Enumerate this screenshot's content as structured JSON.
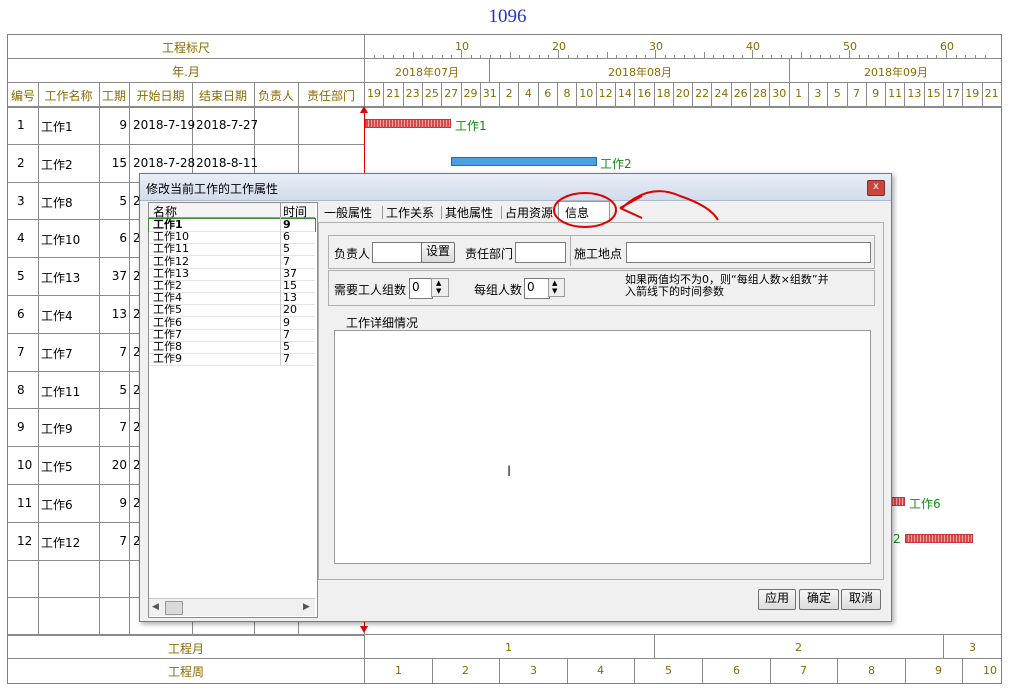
{
  "page_number": "1096",
  "header": {
    "ruler_label": "工程标尺",
    "month_label": "年.月",
    "ruler_ticks": [
      "10",
      "20",
      "30",
      "40",
      "50",
      "60"
    ],
    "months": [
      "2018年07月",
      "2018年08月",
      "2018年09月"
    ],
    "days": [
      "19",
      "21",
      "23",
      "25",
      "27",
      "29",
      "31",
      "2",
      "4",
      "6",
      "8",
      "10",
      "12",
      "14",
      "16",
      "18",
      "20",
      "22",
      "24",
      "26",
      "28",
      "30",
      "1",
      "3",
      "5",
      "7",
      "9",
      "11",
      "13",
      "15",
      "17",
      "19",
      "21"
    ]
  },
  "columns": {
    "id": "编号",
    "name": "工作名称",
    "duration": "工期",
    "start": "开始日期",
    "end": "结束日期",
    "owner": "负责人",
    "dept": "责任部门"
  },
  "rows": [
    {
      "id": "1",
      "name": "工作1",
      "dur": "9",
      "start": "2018-7-19",
      "end": "2018-7-27"
    },
    {
      "id": "2",
      "name": "工作2",
      "dur": "15",
      "start": "2018-7-28",
      "end": "2018-8-11"
    },
    {
      "id": "3",
      "name": "工作8",
      "dur": "5",
      "start": "2",
      "end": ""
    },
    {
      "id": "4",
      "name": "工作10",
      "dur": "6",
      "start": "2",
      "end": ""
    },
    {
      "id": "5",
      "name": "工作13",
      "dur": "37",
      "start": "2",
      "end": ""
    },
    {
      "id": "6",
      "name": "工作4",
      "dur": "13",
      "start": "2",
      "end": ""
    },
    {
      "id": "7",
      "name": "工作7",
      "dur": "7",
      "start": "2",
      "end": ""
    },
    {
      "id": "8",
      "name": "工作11",
      "dur": "5",
      "start": "2",
      "end": ""
    },
    {
      "id": "9",
      "name": "工作9",
      "dur": "7",
      "start": "2",
      "end": ""
    },
    {
      "id": "10",
      "name": "工作5",
      "dur": "20",
      "start": "2",
      "end": ""
    },
    {
      "id": "11",
      "name": "工作6",
      "dur": "9",
      "start": "2",
      "end": ""
    },
    {
      "id": "12",
      "name": "工作12",
      "dur": "7",
      "start": "2",
      "end": ""
    }
  ],
  "bars": [
    {
      "label": "工作1",
      "color": "red"
    },
    {
      "label": "工作2",
      "color": "blue"
    },
    {
      "label": "工作6",
      "color": "red"
    },
    {
      "label": "2",
      "color": "red"
    }
  ],
  "footer": {
    "month_label": "工程月",
    "week_label": "工程周",
    "months": [
      "1",
      "2",
      "3"
    ],
    "weeks": [
      "1",
      "2",
      "3",
      "4",
      "5",
      "6",
      "7",
      "8",
      "9",
      "10"
    ]
  },
  "dialog": {
    "title": "修改当前工作的工作属性",
    "close": "x",
    "list_headers": {
      "name": "名称",
      "time": "时间"
    },
    "list": [
      {
        "name": "工作1",
        "time": "9"
      },
      {
        "name": "工作10",
        "time": "6"
      },
      {
        "name": "工作11",
        "time": "5"
      },
      {
        "name": "工作12",
        "time": "7"
      },
      {
        "name": "工作13",
        "time": "37"
      },
      {
        "name": "工作2",
        "time": "15"
      },
      {
        "name": "工作4",
        "time": "13"
      },
      {
        "name": "工作5",
        "time": "20"
      },
      {
        "name": "工作6",
        "time": "9"
      },
      {
        "name": "工作7",
        "time": "7"
      },
      {
        "name": "工作8",
        "time": "5"
      },
      {
        "name": "工作9",
        "time": "7"
      }
    ],
    "tabs": [
      "一般属性",
      "工作关系",
      "其他属性",
      "占用资源",
      "信息"
    ],
    "owner_label": "负责人",
    "owner_value": "",
    "set_button": "设置",
    "dept_label": "责任部门",
    "dept_value": "",
    "site_label": "施工地点",
    "site_value": "",
    "groups_label": "需要工人组数",
    "groups_value": "0",
    "per_group_label": "每组人数",
    "per_group_value": "0",
    "hint_line1": "如果两值均不为0，则“每组人数×组数”并",
    "hint_line2": "入箭线下的时间参数",
    "detail_label": "工作详细情况",
    "detail_value": "",
    "apply": "应用",
    "ok": "确定",
    "cancel": "取消"
  },
  "colors": {
    "accent_text": "#8a6a00",
    "bar_red": "#d94a4a",
    "bar_blue": "#4aa0e0",
    "annotation": "#e00000"
  }
}
